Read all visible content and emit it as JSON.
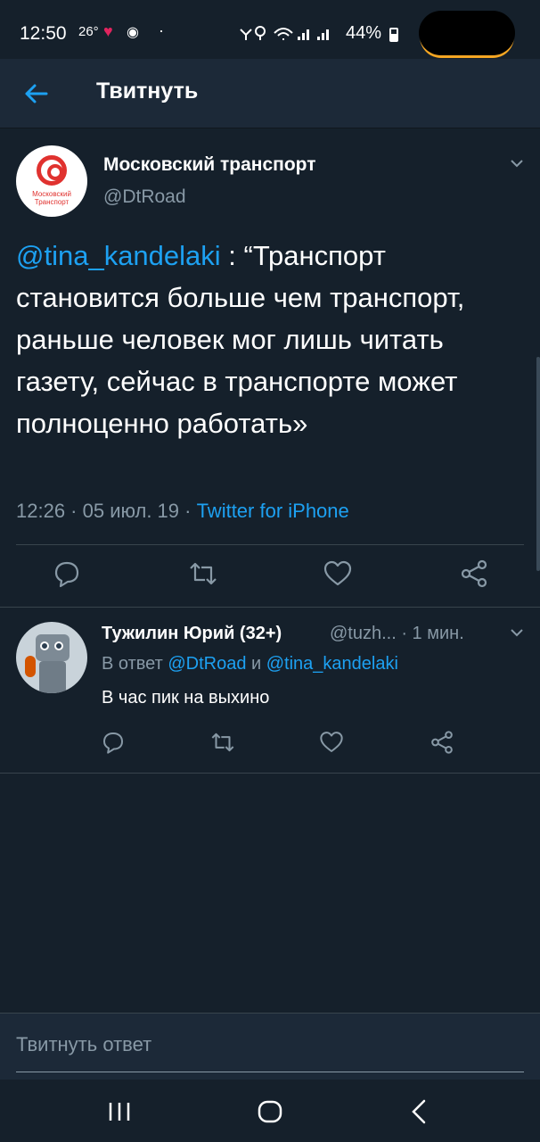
{
  "status_bar": {
    "time": "12:50",
    "temp": "26°",
    "battery": "44%"
  },
  "header": {
    "title": "Твитнуть"
  },
  "tweet": {
    "author_name": "Московский транспорт",
    "author_handle": "@DtRoad",
    "avatar_text": "Московский Транспорт",
    "mention": "@tina_kandelaki",
    "body": " : “Транспорт становится больше чем транспорт, раньше человек мог лишь читать газету, сейчас в транспорте может полноценно работать»",
    "time": "12:26 · 05 июл. 19 · ",
    "source": "Twitter for iPhone"
  },
  "reply": {
    "author_name": "Тужилин Юрий (32+)",
    "author_handle": "@tuzh... · 1 мин.",
    "reply_prefix": "В ответ ",
    "reply_mention_1": "@DtRoad",
    "reply_joiner": " и ",
    "reply_mention_2": "@tina_kandelaki",
    "text": "В час пик на выхино"
  },
  "compose": {
    "placeholder": "Твитнуть ответ"
  },
  "colors": {
    "background": "#15202b",
    "accent": "#1da1f2",
    "secondary_text": "#8899a6"
  }
}
